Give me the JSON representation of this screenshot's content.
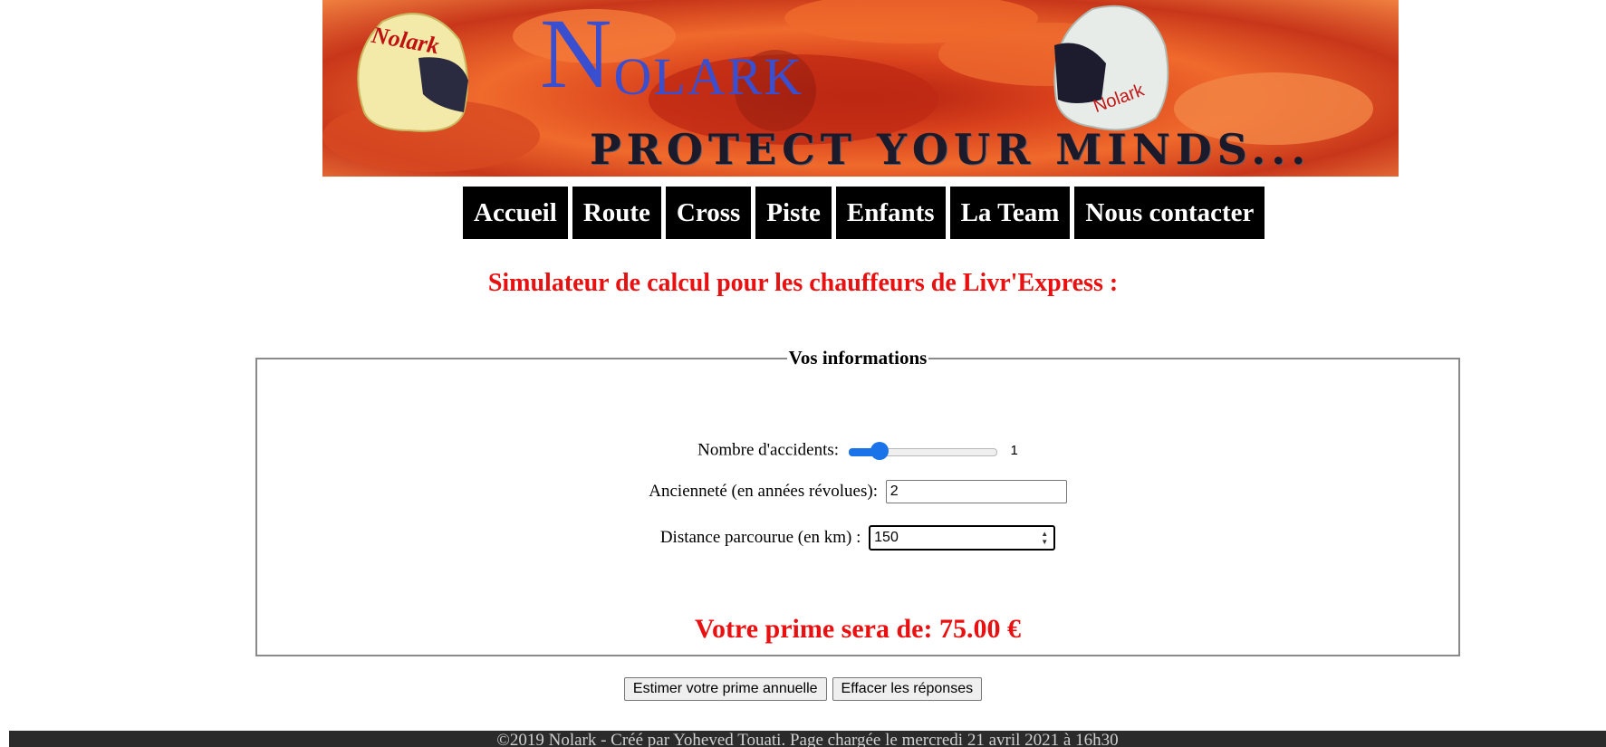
{
  "banner": {
    "logo_initial": "N",
    "logo_rest": "OLARK",
    "tagline": "PROTECT YOUR MINDS...",
    "helmet_left_text": "Nolark",
    "helmet_right_text": "Nolark"
  },
  "nav": {
    "items": [
      {
        "label": "Accueil"
      },
      {
        "label": "Route"
      },
      {
        "label": "Cross"
      },
      {
        "label": "Piste"
      },
      {
        "label": "Enfants"
      },
      {
        "label": "La Team"
      },
      {
        "label": "Nous contacter"
      }
    ]
  },
  "page_title": "Simulateur de calcul pour les chauffeurs de Livr'Express :",
  "form": {
    "legend": "Vos informations",
    "accidents": {
      "label": "Nombre d'accidents:",
      "value": "1",
      "level": 0.167
    },
    "seniority": {
      "label": "Ancienneté (en années révolues):",
      "value": "2"
    },
    "distance": {
      "label": "Distance parcourue (en km) :",
      "value": "150"
    },
    "result": "Votre prime sera de: 75.00 €"
  },
  "buttons": {
    "estimate": "Estimer votre prime annuelle",
    "reset": "Effacer les réponses"
  },
  "footer": {
    "text": "©2019 Nolark - Créé par Yoheved Touati. Page chargée le mercredi 21 avril 2021 à 16h30"
  },
  "colors": {
    "accent_red": "#e81010",
    "nav_bg": "#000000",
    "slider_blue": "#1a73e8",
    "logo_blue": "#3a4fd0",
    "footer_bg": "#2b2b2b"
  }
}
